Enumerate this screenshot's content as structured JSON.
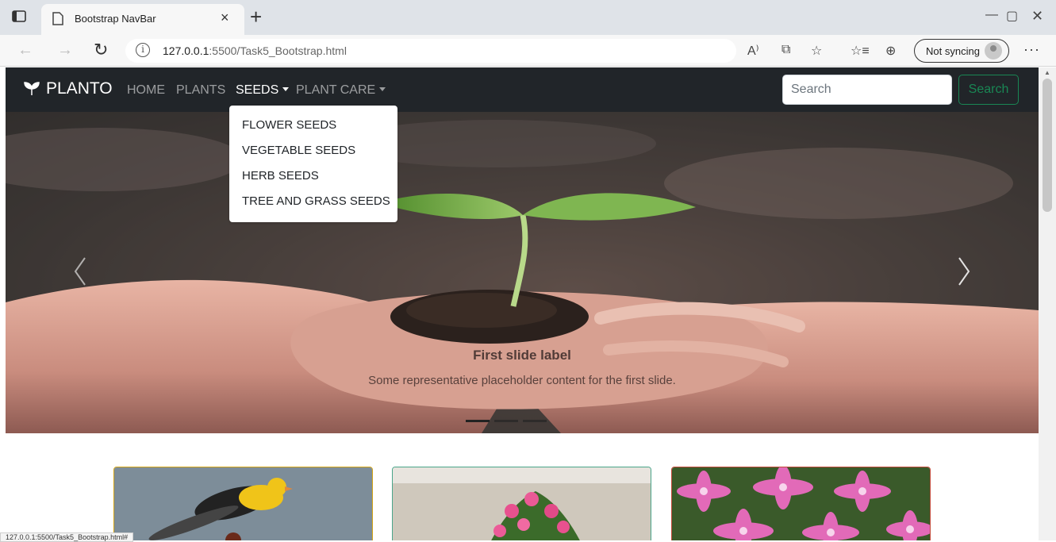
{
  "browser": {
    "tab_title": "Bootstrap NavBar",
    "url_host": "127.0.0.1",
    "url_path": ":5500/Task5_Bootstrap.html",
    "sync_label": "Not syncing",
    "more_label": "···"
  },
  "navbar": {
    "brand": "PLANTO",
    "links": [
      "HOME",
      "PLANTS",
      "SEEDS",
      "PLANT CARE"
    ],
    "search_placeholder": "Search",
    "search_button": "Search",
    "accent_color": "#198754",
    "bg_color": "#212529"
  },
  "dropdown": {
    "items": [
      "FLOWER SEEDS",
      "VEGETABLE SEEDS",
      "HERB SEEDS",
      "TREE AND GRASS SEEDS"
    ]
  },
  "carousel": {
    "caption_title": "First slide label",
    "caption_text": "Some representative placeholder content for the first slide.",
    "indicator_count": 3,
    "active_indicator": 1
  },
  "status_bar": {
    "url": "127.0.0.1:5500/Task5_Bootstrap.html#"
  }
}
